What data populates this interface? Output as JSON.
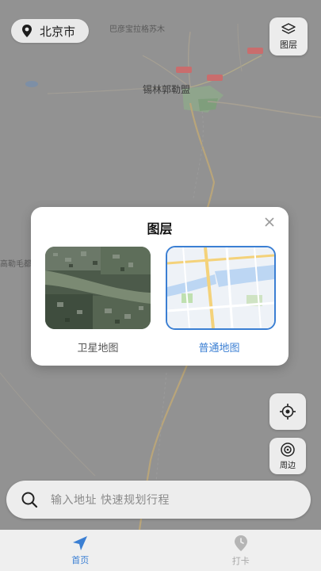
{
  "header": {
    "city": "北京市",
    "layer_button_label": "图层"
  },
  "map_labels": {
    "top_town": "巴彦宝拉格苏木",
    "main_city": "锡林郭勒盟",
    "left_town": "高勒毛都"
  },
  "layer_dialog": {
    "title": "图层",
    "options": [
      {
        "label": "卫星地图",
        "selected": false
      },
      {
        "label": "普通地图",
        "selected": true
      }
    ]
  },
  "side_buttons": {
    "locate_label": "",
    "nearby_label": "周边"
  },
  "search": {
    "placeholder": "输入地址 快速规划行程"
  },
  "tabs": [
    {
      "label": "首页",
      "active": true
    },
    {
      "label": "打卡",
      "active": false
    }
  ],
  "colors": {
    "accent": "#3b7fd3",
    "inactive": "#b0b0b0",
    "road": "#c9a35a",
    "park": "#7aa87a"
  }
}
